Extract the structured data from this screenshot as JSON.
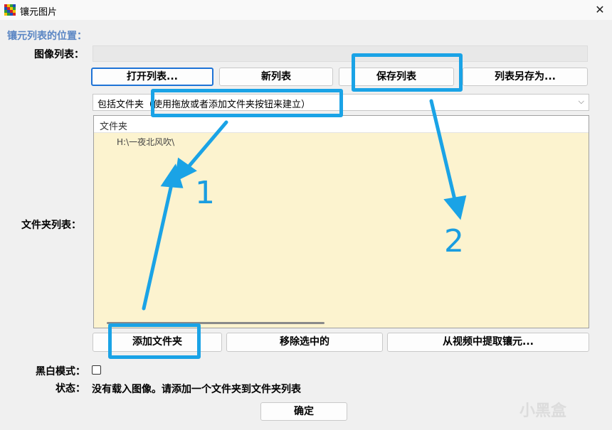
{
  "window": {
    "title": "镶元图片",
    "close_glyph": "✕"
  },
  "section_title": "镶元列表的位置：",
  "image_list": {
    "label": "图像列表：",
    "value": ""
  },
  "list_buttons": {
    "open": "打开列表...",
    "new": "新列表",
    "save": "保存列表",
    "save_as": "列表另存为..."
  },
  "include_select": {
    "value": "包括文件夹（使用拖放或者添加文件夹按钮来建立）"
  },
  "folder_list": {
    "label": "文件夹列表：",
    "column_header": "文件夹",
    "items": [
      "H:\\一夜北风吹\\"
    ]
  },
  "folder_buttons": {
    "add": "添加文件夹",
    "remove": "移除选中的",
    "extract": "从视频中提取镶元..."
  },
  "bw_mode": {
    "label": "黑白模式：",
    "checked": false
  },
  "status": {
    "label": "状态：",
    "text": "没有载入图像。请添加一个文件夹到文件夹列表"
  },
  "ok_button": "确定",
  "annotations": {
    "one": "1",
    "two": "2",
    "color": "#1aa3e6"
  },
  "watermark": "小黑盒"
}
